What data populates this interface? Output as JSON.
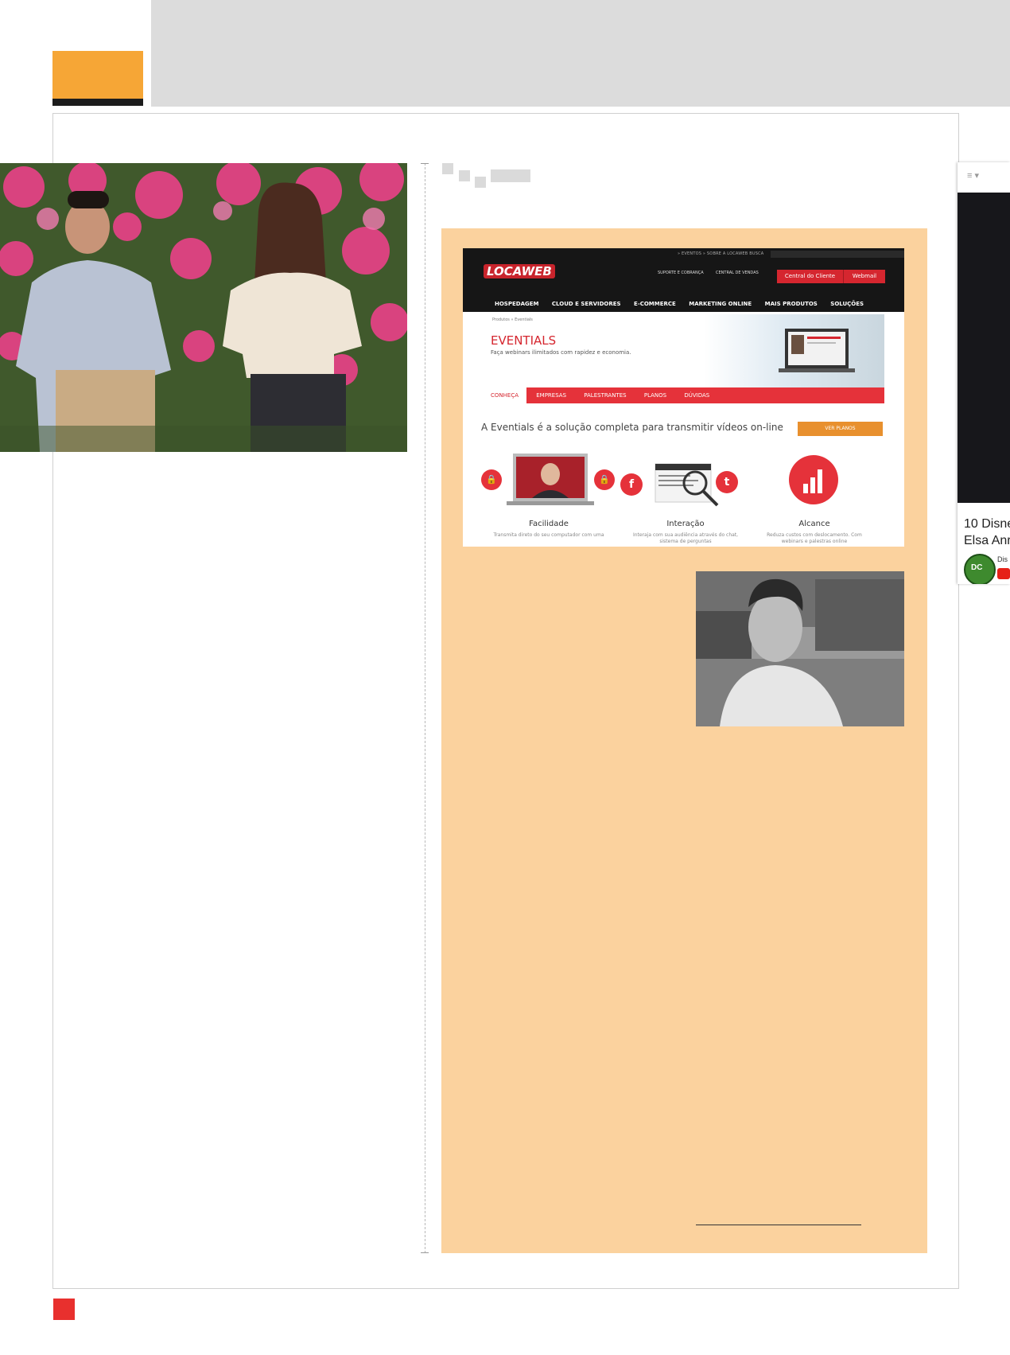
{
  "colors": {
    "accent_orange": "#f6a636",
    "sidebar_bg": "#fbd29e",
    "brand_red": "#d5262f",
    "page_marker_red": "#e8302e"
  },
  "website": {
    "top_links": "» EVENTOS    » SOBRE A LOCAWEB         BUSCA",
    "logo": "LOCAWEB",
    "suporte": "SUPORTE E COBRANÇA",
    "central_vendas": "CENTRAL DE VENDAS",
    "btn_central": "Central do Cliente",
    "btn_webmail": "Webmail",
    "nav": [
      "HOSPEDAGEM",
      "CLOUD E SERVIDORES",
      "E-COMMERCE",
      "MARKETING ONLINE",
      "MAIS PRODUTOS",
      "SOLUÇÕES"
    ],
    "breadcrumb": "Produtos » Eventials",
    "title": "EVENTIALS",
    "subtitle": "Faça webinars ilimitados com rapidez e economia.",
    "tabs": [
      "CONHEÇA",
      "EMPRESAS",
      "PALESTRANTES",
      "PLANOS",
      "DÚVIDAS"
    ],
    "tagline": "A Eventials é a solução completa para transmitir vídeos on-line",
    "btn_planos": "VER PLANOS",
    "features": [
      {
        "label": "Facilidade",
        "desc": "Transmita direto do seu computador com uma"
      },
      {
        "label": "Interação",
        "desc": "Interaja com sua audiência através do chat, sistema de perguntas"
      },
      {
        "label": "Alcance",
        "desc": "Reduza custos com deslocamento. Com webinars e palestras online"
      }
    ]
  },
  "edge_card": {
    "menu": "≡ ▾",
    "title_line1": "10 Disne",
    "title_line2": "Elsa Anr",
    "badge": "DC",
    "channel": "Dis"
  }
}
